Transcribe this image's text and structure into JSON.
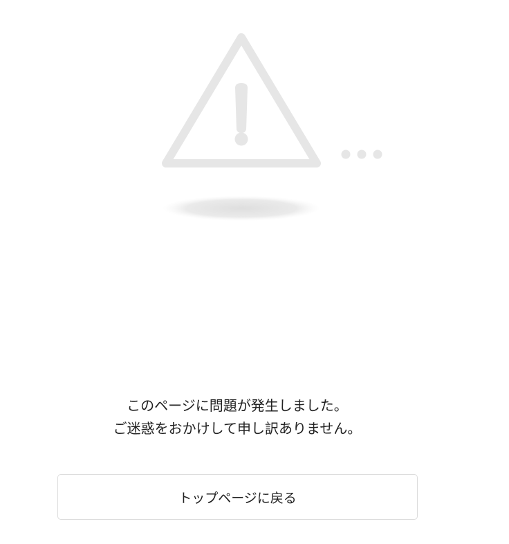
{
  "error": {
    "icon": "warning-triangle-icon",
    "loading_icon": "ellipsis-dots-icon",
    "icon_color": "#e6e6e6",
    "message_line1": "このページに問題が発生しました。",
    "message_line2": "ご迷惑をおかけして申し訳ありません。"
  },
  "actions": {
    "back_to_top_label": "トップページに戻る"
  }
}
